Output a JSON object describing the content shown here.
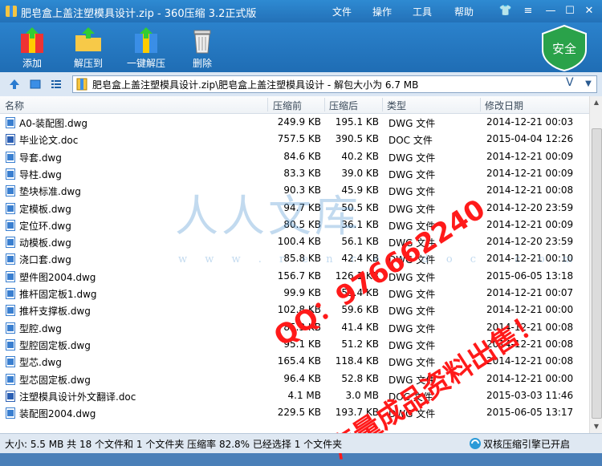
{
  "window": {
    "title": "肥皂盒上盖注塑模具设计.zip - 360压缩 3.2正式版",
    "menu": [
      "文件",
      "操作",
      "工具",
      "帮助"
    ]
  },
  "toolbar": {
    "add": "添加",
    "extract_to": "解压到",
    "one_click": "一键解压",
    "delete": "删除",
    "safe": "安全"
  },
  "address": {
    "path": "肥皂盒上盖注塑模具设计.zip\\肥皂盒上盖注塑模具设计 - 解包大小为 6.7 MB",
    "v": "V"
  },
  "columns": {
    "name": "名称",
    "compressed_before": "压缩前",
    "compressed_after": "压缩后",
    "type": "类型",
    "modified": "修改日期"
  },
  "files": [
    {
      "name": "A0-装配图.dwg",
      "before": "249.9 KB",
      "after": "195.1 KB",
      "type": "DWG 文件",
      "date": "2014-12-21 00:03",
      "icon": "dwg"
    },
    {
      "name": "毕业论文.doc",
      "before": "757.5 KB",
      "after": "390.5 KB",
      "type": "DOC 文件",
      "date": "2015-04-04 12:26",
      "icon": "doc"
    },
    {
      "name": "导套.dwg",
      "before": "84.6 KB",
      "after": "40.2 KB",
      "type": "DWG 文件",
      "date": "2014-12-21 00:09",
      "icon": "dwg"
    },
    {
      "name": "导柱.dwg",
      "before": "83.3 KB",
      "after": "39.0 KB",
      "type": "DWG 文件",
      "date": "2014-12-21 00:09",
      "icon": "dwg"
    },
    {
      "name": "垫块标准.dwg",
      "before": "90.3 KB",
      "after": "45.9 KB",
      "type": "DWG 文件",
      "date": "2014-12-21 00:08",
      "icon": "dwg"
    },
    {
      "name": "定模板.dwg",
      "before": "94.7 KB",
      "after": "50.5 KB",
      "type": "DWG 文件",
      "date": "2014-12-20 23:59",
      "icon": "dwg"
    },
    {
      "name": "定位环.dwg",
      "before": "80.5 KB",
      "after": "36.1 KB",
      "type": "DWG 文件",
      "date": "2014-12-21 00:09",
      "icon": "dwg"
    },
    {
      "name": "动模板.dwg",
      "before": "100.4 KB",
      "after": "56.1 KB",
      "type": "DWG 文件",
      "date": "2014-12-20 23:59",
      "icon": "dwg"
    },
    {
      "name": "浇口套.dwg",
      "before": "85.8 KB",
      "after": "42.4 KB",
      "type": "DWG 文件",
      "date": "2014-12-21 00:10",
      "icon": "dwg"
    },
    {
      "name": "塑件图2004.dwg",
      "before": "156.7 KB",
      "after": "126.1 KB",
      "type": "DWG 文件",
      "date": "2015-06-05 13:18",
      "icon": "dwg"
    },
    {
      "name": "推杆固定板1.dwg",
      "before": "99.9 KB",
      "after": "55.4 KB",
      "type": "DWG 文件",
      "date": "2014-12-21 00:07",
      "icon": "dwg"
    },
    {
      "name": "推杆支撑板.dwg",
      "before": "102.8 KB",
      "after": "59.6 KB",
      "type": "DWG 文件",
      "date": "2014-12-21 00:00",
      "icon": "dwg"
    },
    {
      "name": "型腔.dwg",
      "before": "85.3 KB",
      "after": "41.4 KB",
      "type": "DWG 文件",
      "date": "2014-12-21 00:08",
      "icon": "dwg"
    },
    {
      "name": "型腔固定板.dwg",
      "before": "95.1 KB",
      "after": "51.2 KB",
      "type": "DWG 文件",
      "date": "2014-12-21 00:08",
      "icon": "dwg"
    },
    {
      "name": "型芯.dwg",
      "before": "165.4 KB",
      "after": "118.4 KB",
      "type": "DWG 文件",
      "date": "2014-12-21 00:08",
      "icon": "dwg"
    },
    {
      "name": "型芯固定板.dwg",
      "before": "96.4 KB",
      "after": "52.8 KB",
      "type": "DWG 文件",
      "date": "2014-12-21 00:00",
      "icon": "dwg"
    },
    {
      "name": "注塑模具设计外文翻译.doc",
      "before": "4.1 MB",
      "after": "3.0 MB",
      "type": "DOC 文件",
      "date": "2015-03-03 11:46",
      "icon": "doc"
    },
    {
      "name": "装配图2004.dwg",
      "before": "229.5 KB",
      "after": "193.7 KB",
      "type": "DWG 文件",
      "date": "2015-06-05 13:17",
      "icon": "dwg"
    }
  ],
  "status": {
    "summary": "大小: 5.5 MB 共 18 个文件和 1 个文件夹 压缩率 82.8% 已经选择 1 个文件夹",
    "engine": "双核压缩引擎已开启"
  },
  "watermark": {
    "logo": "人人文库",
    "url": "w w w . r e n r e n d o c . c o m",
    "qq": "QQ：976662240",
    "sale": "海量成品资料出售！"
  }
}
